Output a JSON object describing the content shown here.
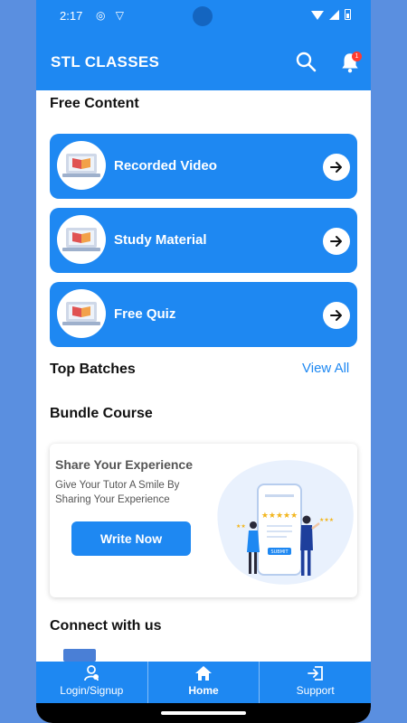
{
  "status_bar": {
    "time": "2:17",
    "left_icons": "◎ ▽"
  },
  "app_bar": {
    "title": "STL CLASSES",
    "notification_count": "1"
  },
  "free_content": {
    "title": "Free Content",
    "items": [
      {
        "label": "Recorded Video"
      },
      {
        "label": "Study Material"
      },
      {
        "label": "Free Quiz"
      }
    ]
  },
  "top_batches": {
    "title": "Top Batches",
    "view_all": "View All"
  },
  "bundle_course": {
    "title": "Bundle Course"
  },
  "banner": {
    "title": "Share Your Experience",
    "text": "Give Your Tutor A Smile By Sharing Your Experience",
    "button": "Write Now",
    "illustration_button": "SUBMIT"
  },
  "connect": {
    "title": "Connect with us"
  },
  "bottom_nav": {
    "items": [
      {
        "label": "Login/Signup",
        "icon": "user-icon"
      },
      {
        "label": "Home",
        "icon": "home-icon"
      },
      {
        "label": "Support",
        "icon": "support-icon"
      }
    ]
  },
  "colors": {
    "primary": "#1e88f2",
    "background": "#5a8fe0",
    "badge": "#ff3b30"
  }
}
